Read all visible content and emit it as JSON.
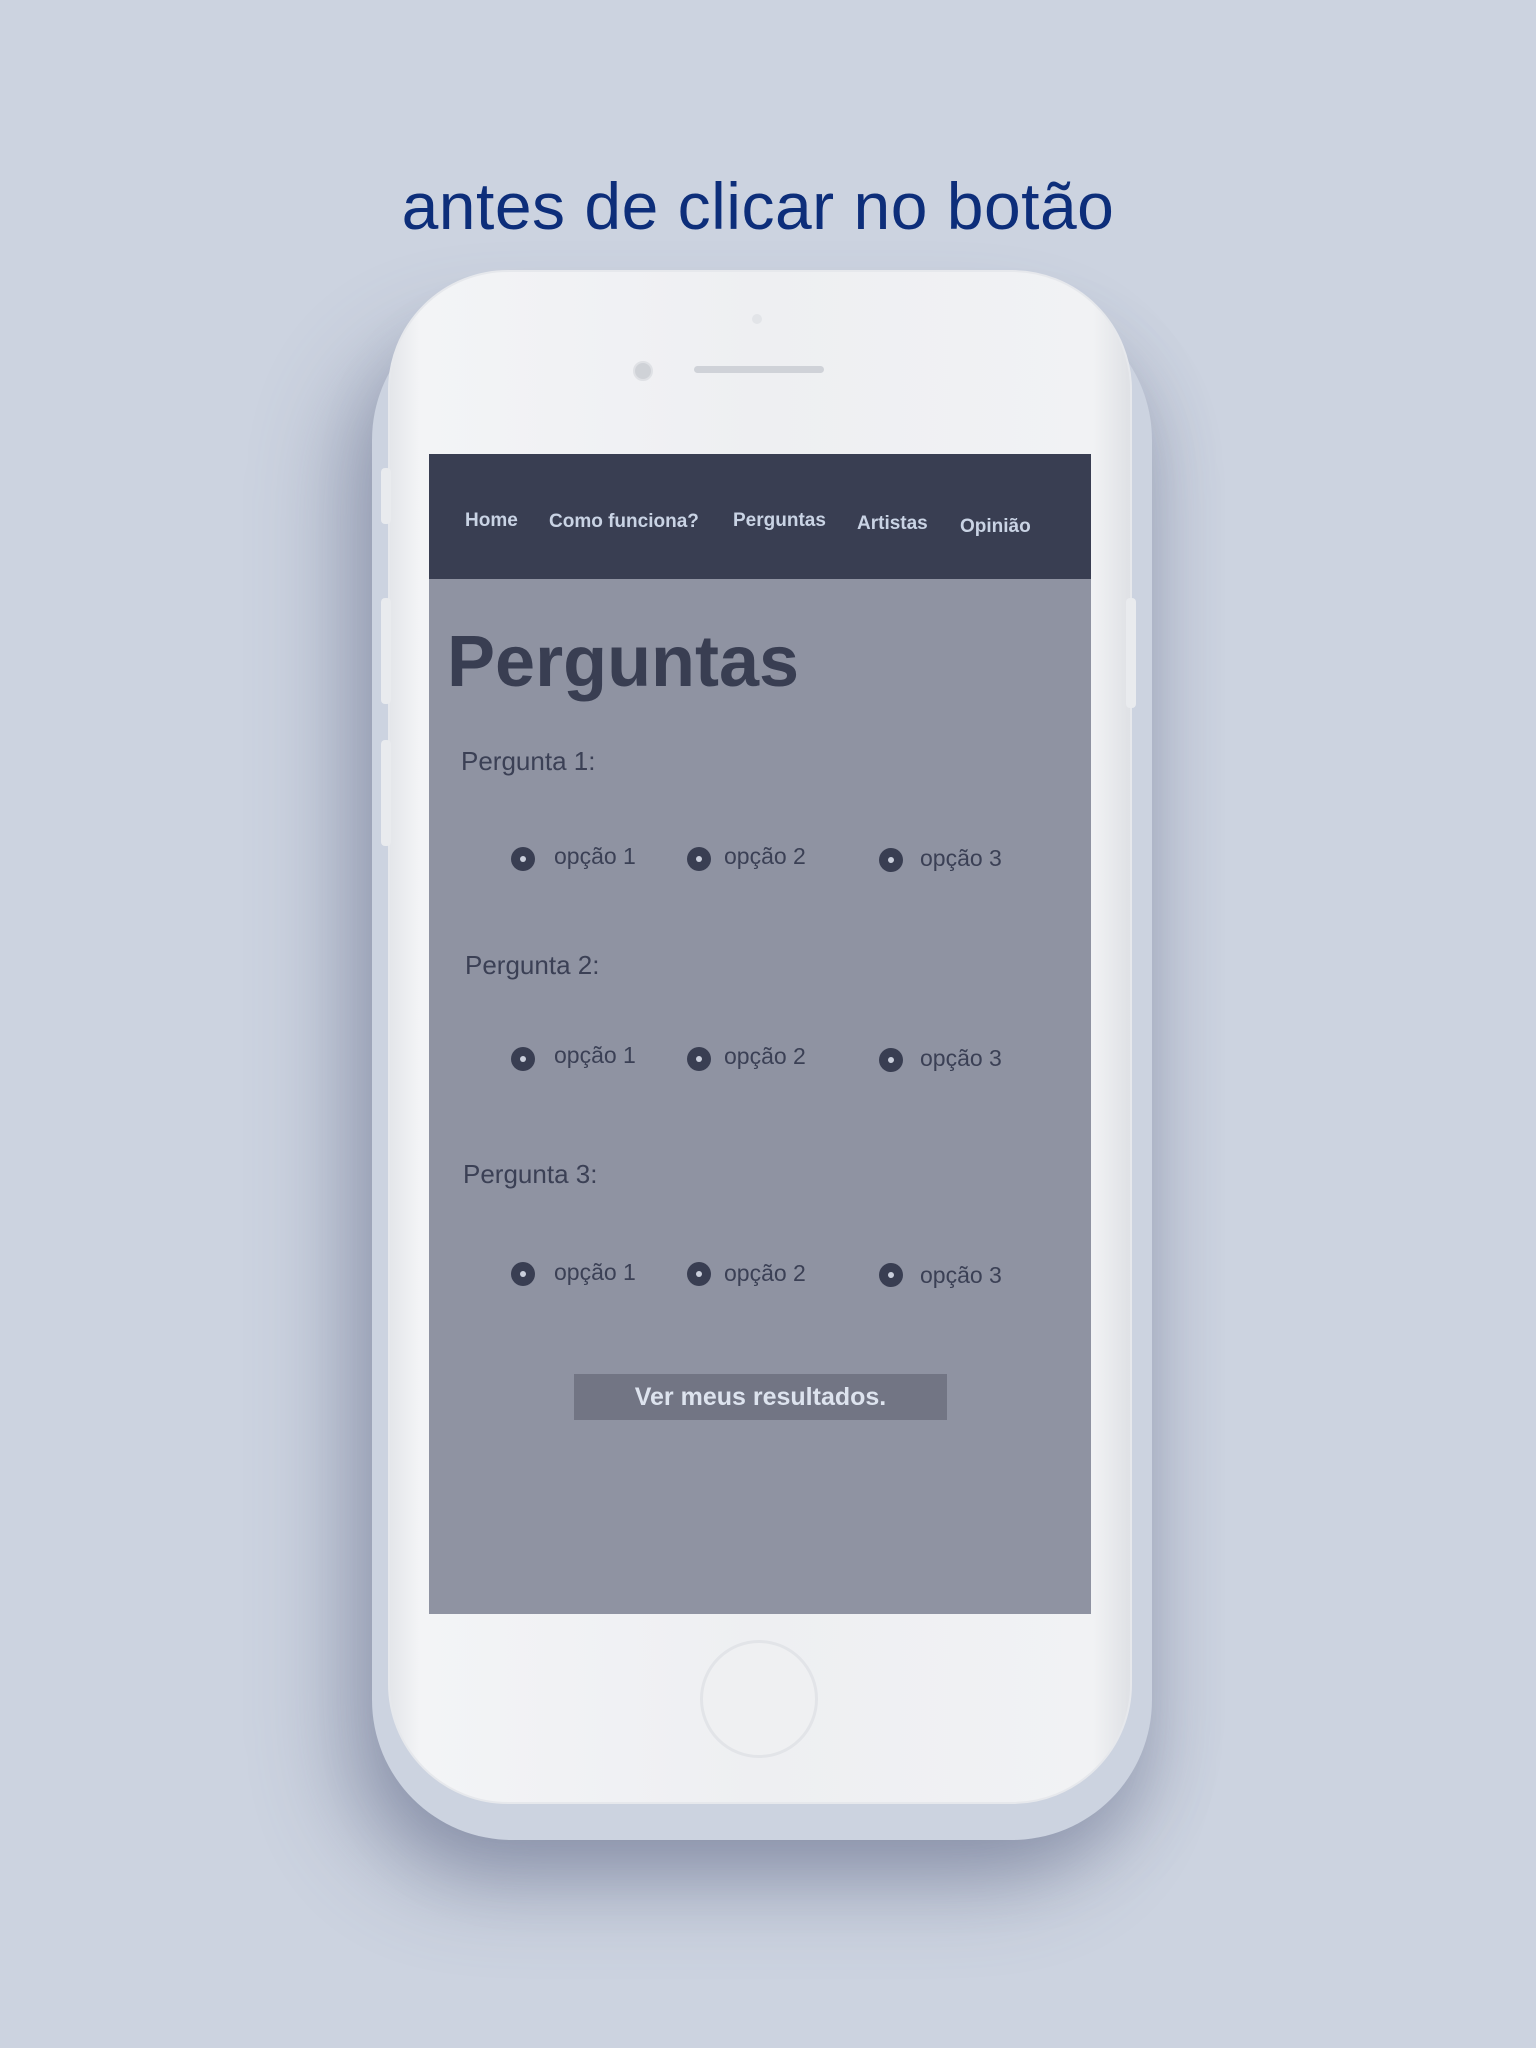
{
  "caption": "antes de clicar no botão",
  "nav": {
    "items": [
      {
        "label": "Home"
      },
      {
        "label": "Como funciona?"
      },
      {
        "label": "Perguntas"
      },
      {
        "label": "Artistas"
      },
      {
        "label": "Opinião"
      }
    ]
  },
  "page": {
    "title": "Perguntas"
  },
  "questions": [
    {
      "label": "Pergunta 1:",
      "options": [
        {
          "label": "opção 1"
        },
        {
          "label": "opção 2"
        },
        {
          "label": "opção 3"
        }
      ]
    },
    {
      "label": "Pergunta 2:",
      "options": [
        {
          "label": "opção 1"
        },
        {
          "label": "opção 2"
        },
        {
          "label": "opção 3"
        }
      ]
    },
    {
      "label": "Pergunta 3:",
      "options": [
        {
          "label": "opção 1"
        },
        {
          "label": "opção 2"
        },
        {
          "label": "opção 3"
        }
      ]
    }
  ],
  "result_button": {
    "label": "Ver meus resultados."
  },
  "colors": {
    "navbar": "#393e52",
    "screen_background": "#8f93a2",
    "caption": "#0d2e7a",
    "button": "#727584"
  }
}
